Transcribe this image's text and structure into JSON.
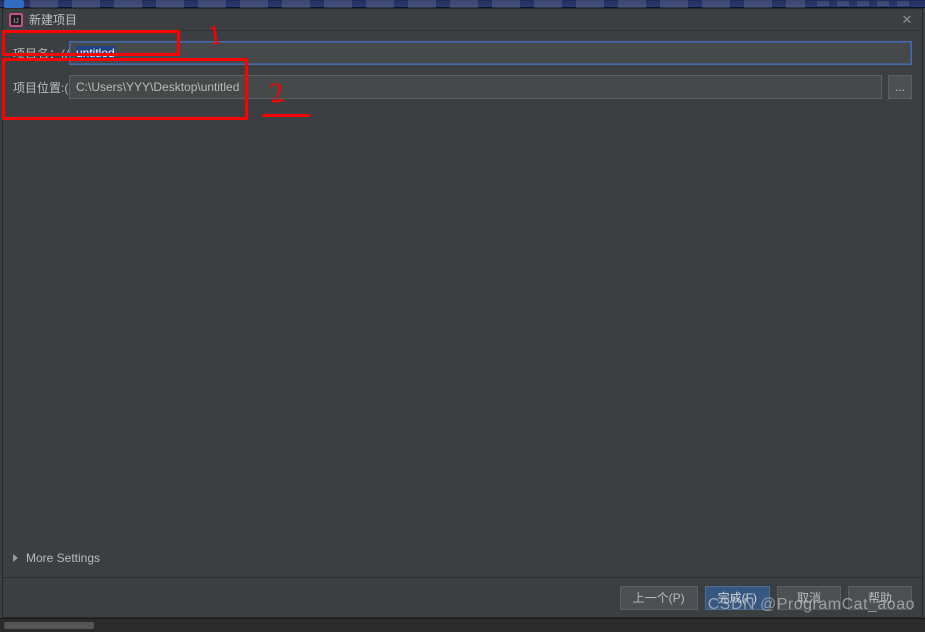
{
  "titlebar": {
    "title": "新建项目",
    "close_icon": "close-icon"
  },
  "form": {
    "project_name": {
      "label": "项目名：(A)",
      "value": "untitled"
    },
    "project_location": {
      "label": "项目位置:(L)",
      "value": "C:\\Users\\YYY\\Desktop\\untitled",
      "browse_label": "..."
    }
  },
  "more_settings": {
    "label": "More Settings"
  },
  "footer": {
    "previous": "上一个(P)",
    "finish": "完成(F)",
    "cancel": "取消",
    "help": "帮助"
  },
  "annotations": {
    "box1": "1",
    "box2": "2"
  },
  "watermark": "CSDN @ProgramCat_aoao"
}
